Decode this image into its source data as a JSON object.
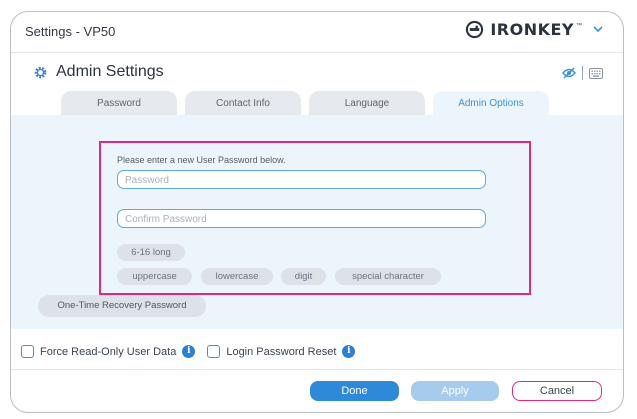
{
  "window": {
    "title": "Settings - VP50",
    "brand": "IRONKEY",
    "brand_tm": "™"
  },
  "header": {
    "title": "Admin Settings"
  },
  "tabs": [
    {
      "label": "Password",
      "active": false
    },
    {
      "label": "Contact Info",
      "active": false
    },
    {
      "label": "Language",
      "active": false
    },
    {
      "label": "Admin Options",
      "active": true
    }
  ],
  "password_panel": {
    "instruction": "Please enter a new User Password below.",
    "password_placeholder": "Password",
    "confirm_placeholder": "Confirm Password",
    "rules": [
      "6-16 long",
      "uppercase",
      "lowercase",
      "digit",
      "special character"
    ]
  },
  "otr_button": "One-Time Recovery Password",
  "options": {
    "force_readonly": {
      "label": "Force Read-Only User Data",
      "checked": false
    },
    "login_reset": {
      "label": "Login Password Reset",
      "checked": false
    }
  },
  "buttons": {
    "done": "Done",
    "apply": "Apply",
    "cancel": "Cancel"
  },
  "colors": {
    "accent": "#2f89d9",
    "highlight": "#e2287a",
    "panel": "#edf5fc"
  }
}
